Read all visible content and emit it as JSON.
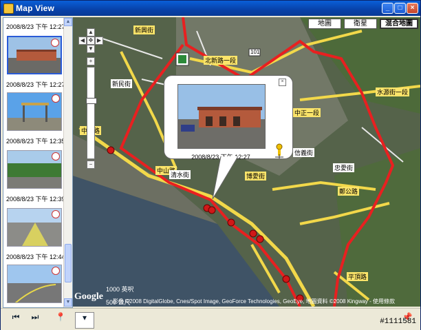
{
  "window": {
    "title": "Map View",
    "controls": [
      "minimize",
      "maximize",
      "close"
    ]
  },
  "sidebar": {
    "items": [
      {
        "label": "2008/8/23 下午 12:27",
        "selected": false
      },
      {
        "label": "2008/8/23 下午 12:27",
        "selected": true
      },
      {
        "label": "2008/8/23 下午 12:35",
        "selected": false
      },
      {
        "label": "2008/8/23 下午 12:39",
        "selected": false
      },
      {
        "label": "2008/8/23 下午 12:44",
        "selected": false
      }
    ]
  },
  "map": {
    "types": [
      {
        "label": "地圖",
        "active": false
      },
      {
        "label": "衛星",
        "active": false
      },
      {
        "label": "混合地圖",
        "active": true
      }
    ],
    "street_labels": [
      "新興街",
      "中正路",
      "中山路",
      "清水街",
      "北新路一段",
      "新民街",
      "信義街",
      "博愛街",
      "鄭公路",
      "水源街一段",
      "中正一段",
      "忠愛街",
      "平頂路"
    ],
    "route_badge": "101",
    "infowindow": {
      "caption": "2008/8/23 下午 12:27"
    },
    "scale_top": "1000 英呎",
    "scale_bottom": "500 公尺",
    "logo": "Google",
    "copyright": "影像 ©2008 DigitalGlobe, Cnes/Spot Image, GeoForce Technologies, GeoEye, 地圖資料 ©2008 Kingway - 使用條款"
  },
  "watermark": "#1111581",
  "colors": {
    "titlebar": "#0a5fd8",
    "route": "#e82020",
    "road": "#f2d84a",
    "selection": "#2a5bd7"
  }
}
